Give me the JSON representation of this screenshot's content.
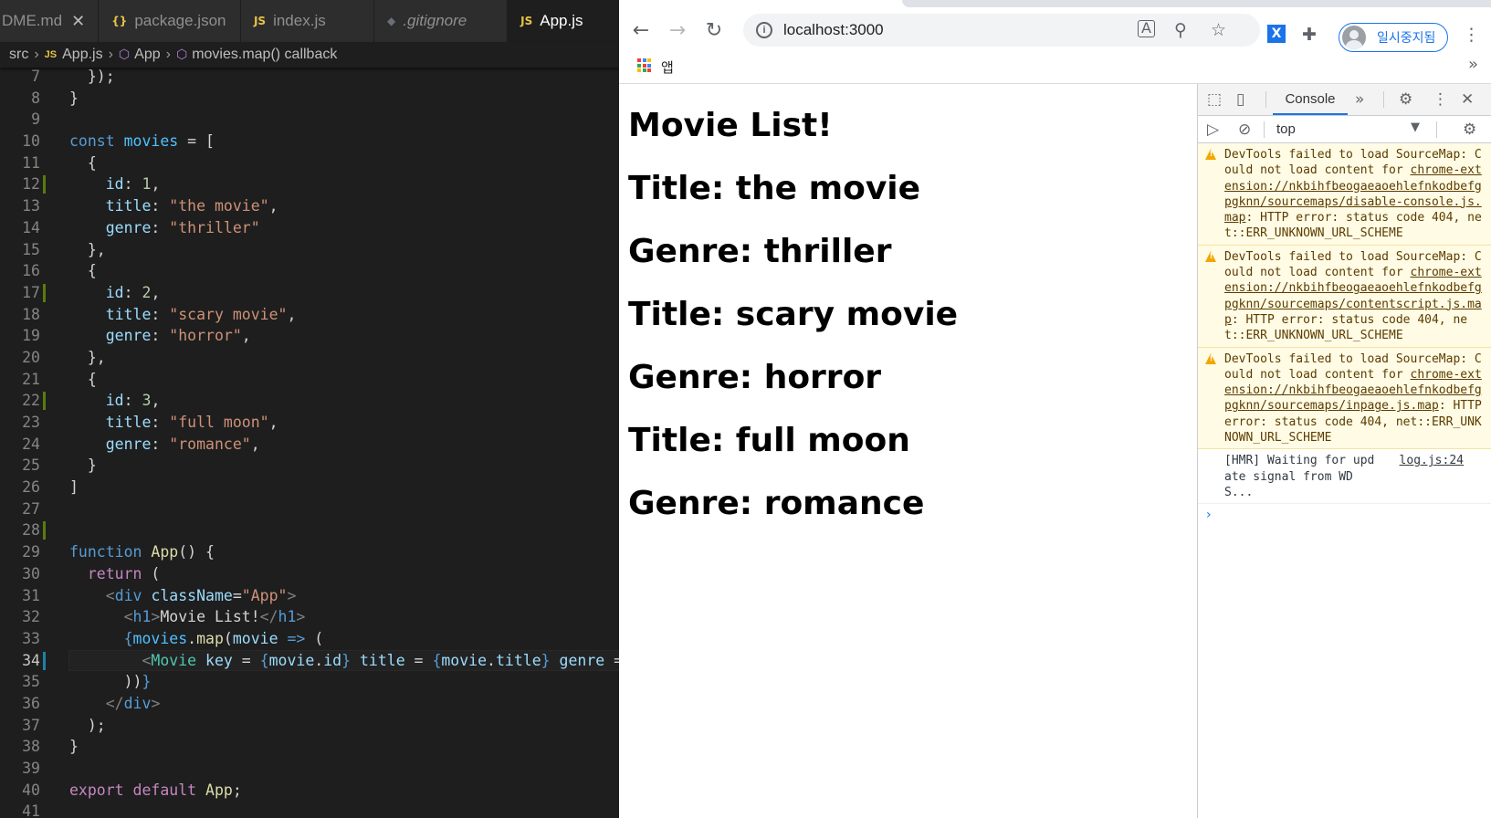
{
  "editor": {
    "tabs": [
      {
        "label": "DME.md",
        "icon": "markdown",
        "close": "✕",
        "active": false
      },
      {
        "label": "package.json",
        "icon": "json",
        "active": false
      },
      {
        "label": "index.js",
        "icon": "js",
        "active": false
      },
      {
        "label": ".gitignore",
        "icon": "git",
        "active": false
      },
      {
        "label": "App.js",
        "icon": "js",
        "active": true
      }
    ],
    "breadcrumb": [
      "src",
      "App.js",
      "App",
      "movies.map() callback"
    ],
    "line_numbers": [
      "7",
      "8",
      "9",
      "10",
      "11",
      "12",
      "13",
      "14",
      "15",
      "16",
      "17",
      "18",
      "19",
      "20",
      "21",
      "22",
      "23",
      "24",
      "25",
      "26",
      "27",
      "28",
      "29",
      "30",
      "31",
      "32",
      "33",
      "34",
      "35",
      "36",
      "37",
      "38",
      "39",
      "40",
      "41"
    ],
    "current_line": "34"
  },
  "browser": {
    "url": "localhost:3000",
    "profile_label": "일시중지됨",
    "bookmarks_apps_label": "앱",
    "page": {
      "heading": "Movie List!",
      "movie_lines": [
        "Title: the movie",
        "Genre: thriller",
        "Title: scary movie",
        "Genre: horror",
        "Title: full moon",
        "Genre: romance"
      ]
    }
  },
  "devtools": {
    "active_tab": "Console",
    "context": "top",
    "messages": [
      {
        "type": "warning",
        "pre": "DevTools failed to load SourceMap: Could not load content for ",
        "link": "chrome-extension://nkbihfbeogaeaoehlefnkodbefgpgknn/sourcemaps/disable-console.js.map",
        "post": ": HTTP error: status code 404, net::ERR_UNKNOWN_URL_SCHEME"
      },
      {
        "type": "warning",
        "pre": "DevTools failed to load SourceMap: Could not load content for ",
        "link": "chrome-extension://nkbihfbeogaeaoehlefnkodbefgpgknn/sourcemaps/contentscript.js.map",
        "post": ": HTTP error: status code 404, net::ERR_UNKNOWN_URL_SCHEME"
      },
      {
        "type": "warning",
        "pre": "DevTools failed to load SourceMap: Could not load content for ",
        "link": "chrome-extension://nkbihfbeogaeaoehlefnkodbefgpgknn/sourcemaps/inpage.js.map",
        "post": ": HTTP error: status code 404, net::ERR_UNKNOWN_URL_SCHEME"
      },
      {
        "type": "log",
        "text": "[HMR] Waiting for update signal from WDS...",
        "source": "log.js:24"
      }
    ],
    "prompt": "›"
  }
}
